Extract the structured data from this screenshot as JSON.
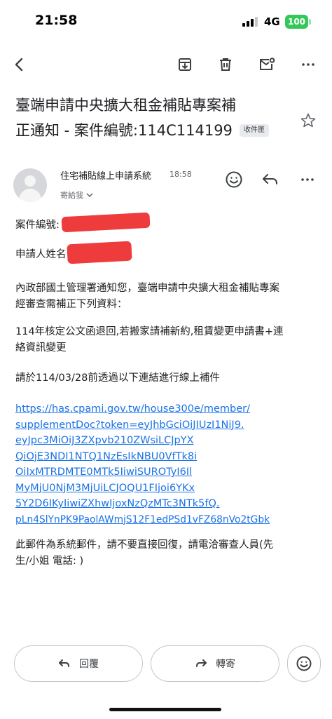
{
  "status_bar": {
    "time": "21:58",
    "network": "4G",
    "battery": "100"
  },
  "toolbar": {
    "back_icon": "arrow-left-icon",
    "archive_icon": "archive-icon",
    "delete_icon": "trash-icon",
    "unread_icon": "mail-unread-icon",
    "more_icon": "more-horizontal-icon"
  },
  "email": {
    "subject_line1": "臺端申請中央擴大租金補貼專案補",
    "subject_line2": "正通知 - 案件編號:114C114199",
    "label_chip": "收件匣",
    "sender_name": "住宅補貼線上申請系統",
    "sent_time": "18:58",
    "to_line": "寄給我",
    "body": {
      "case_no_label": "案件編號:",
      "applicant_label": "申請人姓名",
      "para1_line1": "內政部國土管理署通知您，臺端申請中央擴大租金補貼專案",
      "para1_line2": "經審查需補正下列資料：",
      "para2_line1": "114年核定公文函退回,若搬家請補新約,租賃變更申請書+連",
      "para2_line2": "絡資訊變更",
      "para3": "請於114/03/28前透過以下連結進行線上補件",
      "link_lines": [
        "https://has.cpami.gov.tw/house300e/member/",
        "supplementDoc?token=eyJhbGciOiJIUzI1NiJ9.",
        "eyJpc3MiOiJ3ZXpvb210ZWsiLCJpYX",
        "QiOjE3NDI1NTQ1NzEsIkNBU0VfTk8i",
        "OiIxMTRDMTE0MTk5IiwiSUROTyI6Il",
        "MyMjU0NjM3MjUiLCJOQU1FIjoi6YKx",
        "5Y2D6IKyIiwiZXhwIjoxNzQzMTc3NTk5fQ.",
        "pLn4SlYnPK9PaolAWmjS12F1edPSd1vFZ68nVo2tGbk"
      ],
      "footer_line1": "此郵件為系統郵件，請不要直接回復，請電洽審查人員(先",
      "footer_line2": "生/小姐 電話: )"
    }
  },
  "actions": {
    "reply_label": "回覆",
    "forward_label": "轉寄"
  },
  "colors": {
    "link": "#1a73e8",
    "redaction": "#ee3b3b",
    "battery": "#34c759"
  }
}
